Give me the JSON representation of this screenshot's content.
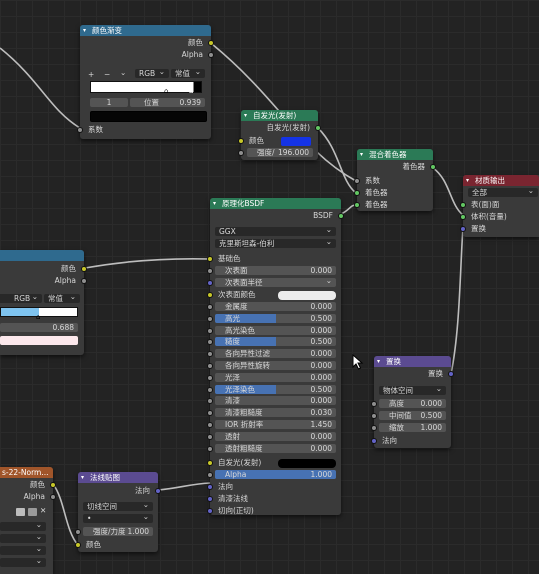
{
  "colorramp": {
    "title": "颜色渐变",
    "out_color": "颜色",
    "out_alpha": "Alpha",
    "tools": [
      "+",
      "−",
      "⌄"
    ],
    "mode": "RGB",
    "interp": "常值",
    "index": "1",
    "pos_label": "位置",
    "pos_value": "0.939",
    "in_fac": "系数"
  },
  "emission": {
    "title": "自发光(发射)",
    "out": "自发光(发射)",
    "color_label": "颜色",
    "color": "#1433e6",
    "strength_label": "强度/",
    "strength_value": "196.000"
  },
  "mix": {
    "title": "混合着色器",
    "out": "着色器",
    "in_fac": "系数",
    "in_shader1": "着色器",
    "in_shader2": "着色器"
  },
  "output": {
    "title": "材质输出",
    "target": "全部",
    "surface": "表(面)面",
    "volume": "体积(音量)",
    "displacement": "置换"
  },
  "bsdf": {
    "title": "原理化BSDF",
    "out": "BSDF",
    "distribution": "GGX",
    "subsurface_method": "克里斯坦森-伯利",
    "base_color": "基础色",
    "subsurface_radius": "次表面半径",
    "subsurface_color": "次表面颜色",
    "alpha": "Alpha",
    "alpha_value": "1.000",
    "emission": "自发光(发射)",
    "normal": "法向",
    "clearcoat_normal": "清漆法线",
    "tangent": "切向(正切)",
    "fields": [
      {
        "label": "次表面",
        "value": "0.000",
        "fill": 0
      },
      {
        "label": "金属度",
        "value": "0.000",
        "fill": 0
      },
      {
        "label": "高光",
        "value": "0.500",
        "fill": 0.5
      },
      {
        "label": "高光染色",
        "value": "0.000",
        "fill": 0
      },
      {
        "label": "糙度",
        "value": "0.500",
        "fill": 0.5
      },
      {
        "label": "各向异性过滤",
        "value": "0.000",
        "fill": 0
      },
      {
        "label": "各向异性旋转",
        "value": "0.000",
        "fill": 0
      },
      {
        "label": "光泽",
        "value": "0.000",
        "fill": 0
      },
      {
        "label": "光泽染色",
        "value": "0.500",
        "fill": 0.5
      },
      {
        "label": "清漆",
        "value": "0.000",
        "fill": 0
      },
      {
        "label": "清漆粗糙度",
        "value": "0.030",
        "fill": 0
      },
      {
        "label": "IOR 折射率",
        "value": "1.450",
        "fill": 0
      },
      {
        "label": "透射",
        "value": "0.000",
        "fill": 0
      },
      {
        "label": "透射粗糙度",
        "value": "0.000",
        "fill": 0
      }
    ]
  },
  "leftnode": {
    "out_color": "颜色",
    "out_alpha": "Alpha",
    "mode": "RGB",
    "interp": "常值",
    "pos_value": "0.688"
  },
  "displacement": {
    "title": "置换",
    "out": "置换",
    "space": "物体空间",
    "height_label": "高度",
    "height_value": "0.000",
    "mid_label": "中间值",
    "mid_value": "0.500",
    "scale_label": "缩放",
    "scale_value": "1.000",
    "normal": "法向"
  },
  "image": {
    "title": "s-22-Norm...",
    "out_color": "颜色",
    "out_alpha": "Alpha"
  },
  "normalmap": {
    "title": "法线贴图",
    "out": "法向",
    "space": "切线空间",
    "uv": "•",
    "strength_label": "强度/力度",
    "strength_value": "1.000",
    "in_color": "颜色"
  }
}
